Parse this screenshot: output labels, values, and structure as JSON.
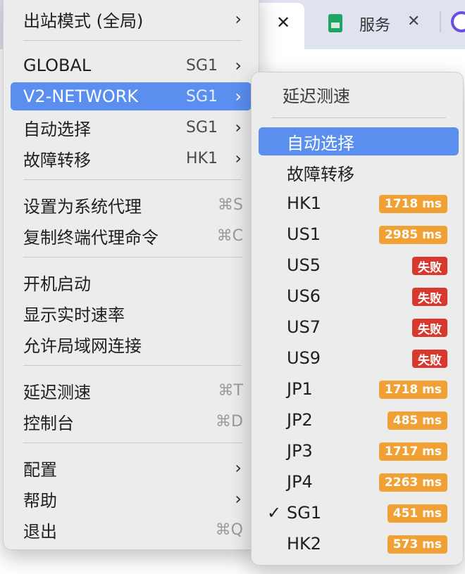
{
  "background": {
    "tab2_label": "服务",
    "close_glyph": "✕"
  },
  "main_menu": {
    "items": [
      {
        "label": "出站模式 (全局)",
        "submenu": true
      },
      {
        "label": "GLOBAL",
        "value": "SG1",
        "submenu": true
      },
      {
        "label": "V2-NETWORK",
        "value": "SG1",
        "submenu": true,
        "highlighted": true
      },
      {
        "label": "自动选择",
        "value": "SG1",
        "submenu": true
      },
      {
        "label": "故障转移",
        "value": "HK1",
        "submenu": true
      },
      {
        "label": "设置为系统代理",
        "shortcut": "⌘S"
      },
      {
        "label": "复制终端代理命令",
        "shortcut": "⌘C"
      },
      {
        "label": "开机启动"
      },
      {
        "label": "显示实时速率"
      },
      {
        "label": "允许局域网连接"
      },
      {
        "label": "延迟测速",
        "shortcut": "⌘T"
      },
      {
        "label": "控制台",
        "shortcut": "⌘D"
      },
      {
        "label": "配置",
        "submenu": true
      },
      {
        "label": "帮助",
        "submenu": true
      },
      {
        "label": "退出",
        "shortcut": "⌘Q"
      }
    ]
  },
  "sub_menu": {
    "header": "延迟测速",
    "items": [
      {
        "label": "自动选择",
        "highlighted": true
      },
      {
        "label": "故障转移"
      },
      {
        "label": "HK1",
        "latency": "1718 ms",
        "status": "ok"
      },
      {
        "label": "US1",
        "latency": "2985 ms",
        "status": "ok"
      },
      {
        "label": "US5",
        "latency": "失败",
        "status": "fail"
      },
      {
        "label": "US6",
        "latency": "失败",
        "status": "fail"
      },
      {
        "label": "US7",
        "latency": "失败",
        "status": "fail"
      },
      {
        "label": "US9",
        "latency": "失败",
        "status": "fail"
      },
      {
        "label": "JP1",
        "latency": "1718 ms",
        "status": "ok"
      },
      {
        "label": "JP2",
        "latency": "485 ms",
        "status": "ok"
      },
      {
        "label": "JP3",
        "latency": "1717 ms",
        "status": "ok"
      },
      {
        "label": "JP4",
        "latency": "2263 ms",
        "status": "ok"
      },
      {
        "label": "SG1",
        "latency": "451 ms",
        "status": "ok",
        "checked": true,
        "check": "✓"
      },
      {
        "label": "HK2",
        "latency": "573 ms",
        "status": "ok"
      }
    ]
  },
  "icons": {
    "chevron": "›"
  },
  "colors": {
    "highlight": "#5a8ff0",
    "latency_ok": "#f1a033",
    "latency_fail": "#d9382c"
  }
}
